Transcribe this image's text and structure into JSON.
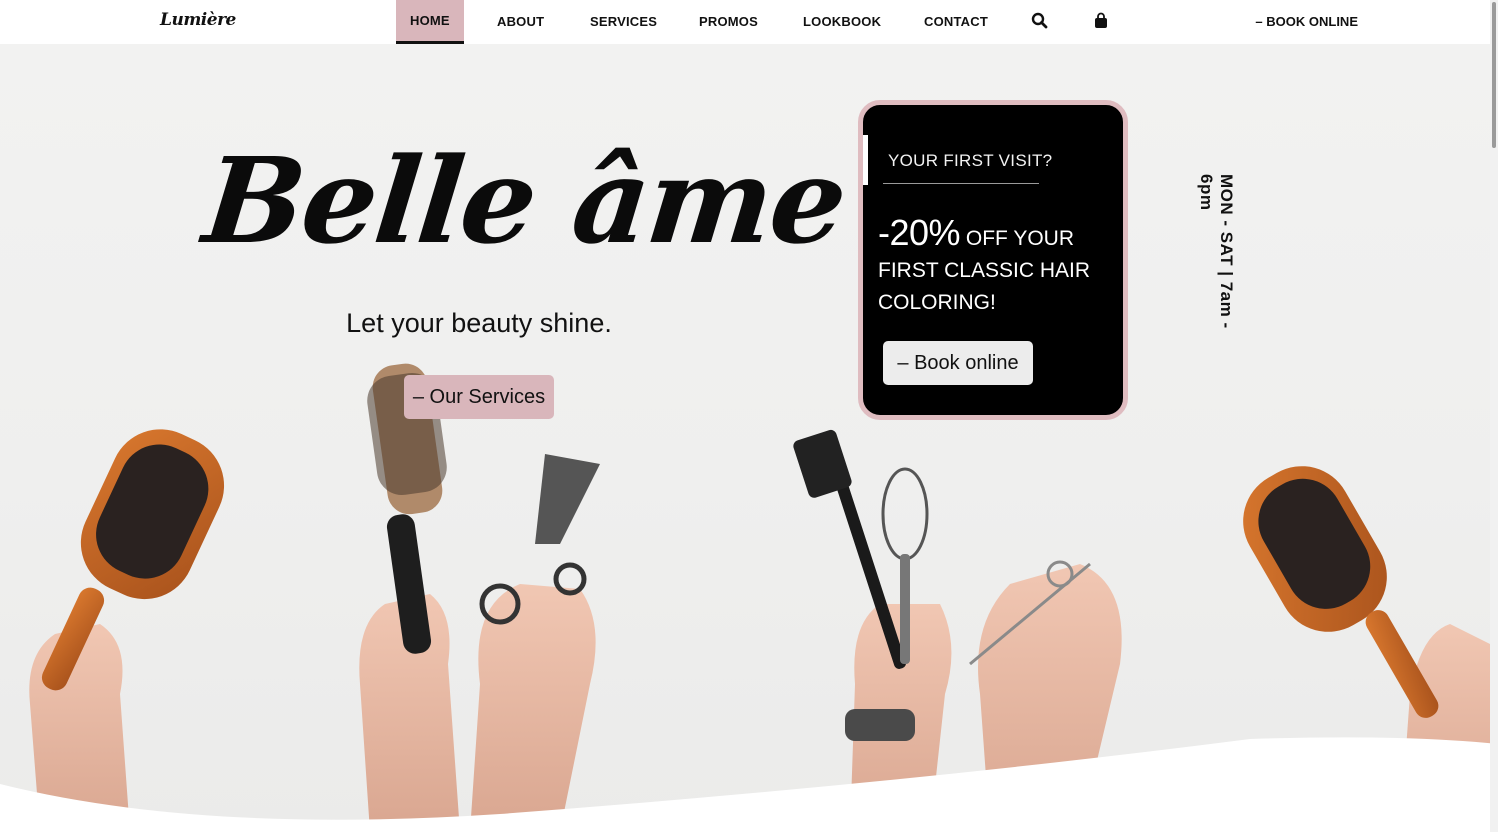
{
  "header": {
    "logo": "Lumière",
    "nav": [
      {
        "label": "HOME",
        "active": true
      },
      {
        "label": "ABOUT",
        "active": false
      },
      {
        "label": "SERVICES",
        "active": false
      },
      {
        "label": "PROMOS",
        "active": false
      },
      {
        "label": "LOOKBOOK",
        "active": false
      },
      {
        "label": "CONTACT",
        "active": false
      }
    ],
    "search_icon": "search-icon",
    "cart_icon": "shopping-bag-icon",
    "book_online_label": "– BOOK ONLINE"
  },
  "hero": {
    "title": "Belle âme",
    "subtitle": "Let your beauty shine.",
    "services_button": "– Our Services"
  },
  "promo": {
    "question": "YOUR FIRST VISIT?",
    "discount": "-20%",
    "offer_text": "OFF YOUR FIRST CLASSIC HAIR COLORING!",
    "button": "– Book online"
  },
  "hours": "MON - SAT | 7am - 6pm",
  "colors": {
    "accent_pink": "#d9b6bb",
    "card_black": "#000000",
    "text_dark": "#111111",
    "hero_bg": "#efefee"
  }
}
